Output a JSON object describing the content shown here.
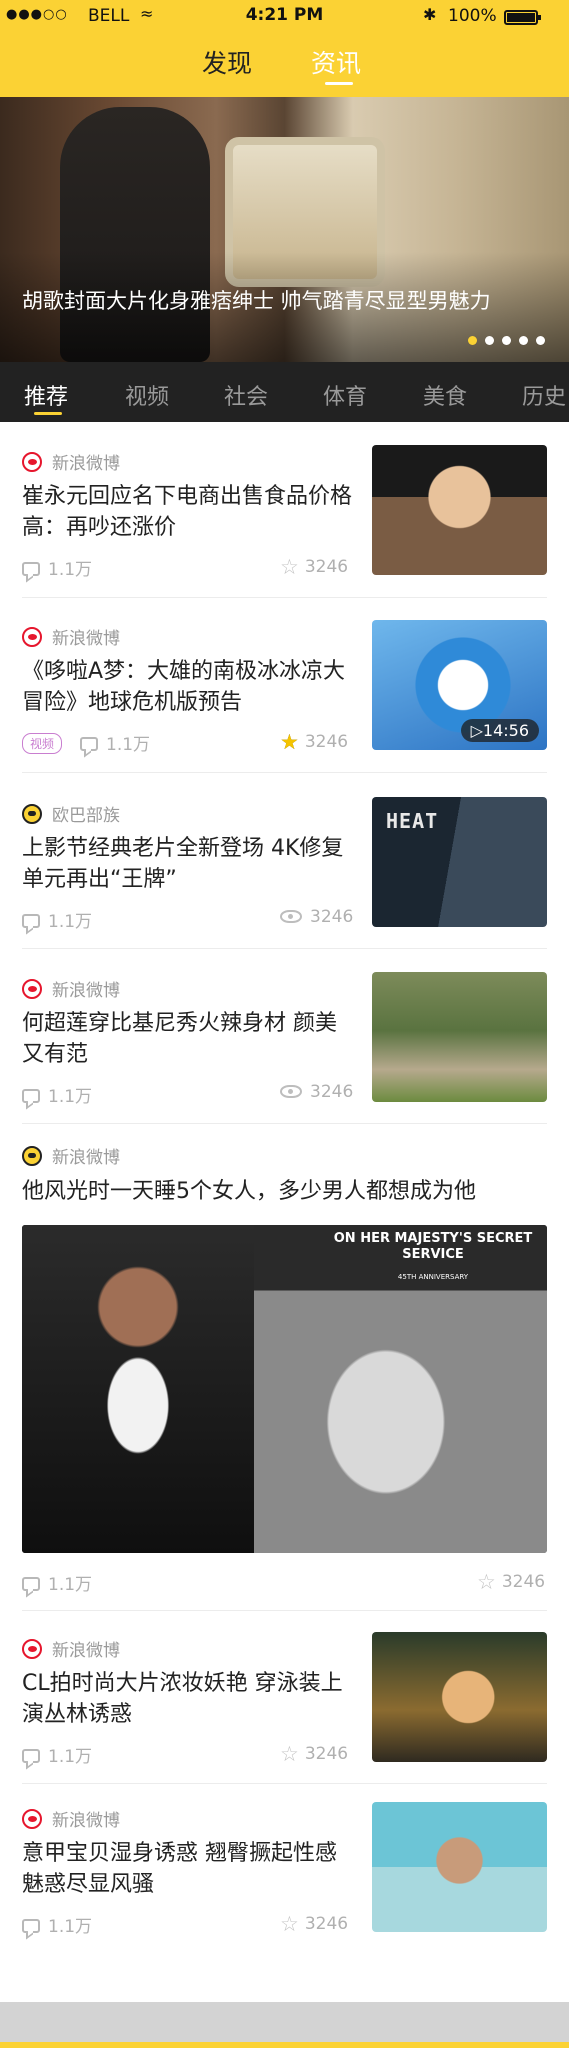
{
  "status_bar": {
    "signal": "●●●○○",
    "carrier": "BELL",
    "time": "4:21 PM",
    "battery": "100%",
    "battery_level": 1.0
  },
  "header": {
    "tabs": [
      "发现",
      "资讯"
    ],
    "active_tab": "资讯"
  },
  "banner": {
    "caption": "胡歌封面大片化身雅痞绅士 帅气踏青尽显型男魅力",
    "slide_count": 5,
    "active_slide": 1
  },
  "categories": {
    "items": [
      "推荐",
      "视频",
      "社会",
      "体育",
      "美食",
      "历史"
    ],
    "active": "推荐"
  },
  "feed": [
    {
      "source": "新浪微博",
      "title": "崔永元回应名下电商出售食品价格高：再吵还涨价",
      "comments": "1.1万",
      "count": "3246",
      "count_icon": "star-icon"
    },
    {
      "source": "新浪微博",
      "title": "《哆啦A梦：大雄的南极冰冰凉大冒险》地球危机版预告",
      "tag": "视频",
      "comments": "1.1万",
      "count": "3246",
      "count_icon": "star-filled-icon",
      "duration": "▷14:56"
    },
    {
      "source": "欧巴部族",
      "title": "上影节经典老片全新登场 4K修复单元再出“王牌”",
      "comments": "1.1万",
      "count": "3246",
      "count_icon": "eye-icon",
      "thumb_text": "HEAT"
    },
    {
      "source": "新浪微博",
      "title": "何超莲穿比基尼秀火辣身材 颜美又有范",
      "comments": "1.1万",
      "count": "3246",
      "count_icon": "eye-icon"
    },
    {
      "source": "新浪微博",
      "title": "他风光时一天睡5个女人，多少男人都想成为他",
      "comments": "1.1万",
      "count": "3246",
      "count_icon": "star-icon",
      "poster_title": "ON HER MAJESTY'S SECRET SERVICE",
      "poster_sub": "45TH ANNIVERSARY"
    },
    {
      "source": "新浪微博",
      "title": "CL拍时尚大片浓妆妖艳 穿泳装上演丛林诱惑",
      "comments": "1.1万",
      "count": "3246",
      "count_icon": "star-icon"
    },
    {
      "source": "新浪微博",
      "title": "意甲宝贝湿身诱惑 翘臀撅起性感魅惑尽显风骚",
      "comments": "1.1万",
      "count": "3246",
      "count_icon": "star-icon"
    }
  ],
  "colors": {
    "accent": "#fbd234",
    "dark_bar": "#222222",
    "weibo_red": "#e6162d",
    "tag_purple": "#c97ed0"
  }
}
